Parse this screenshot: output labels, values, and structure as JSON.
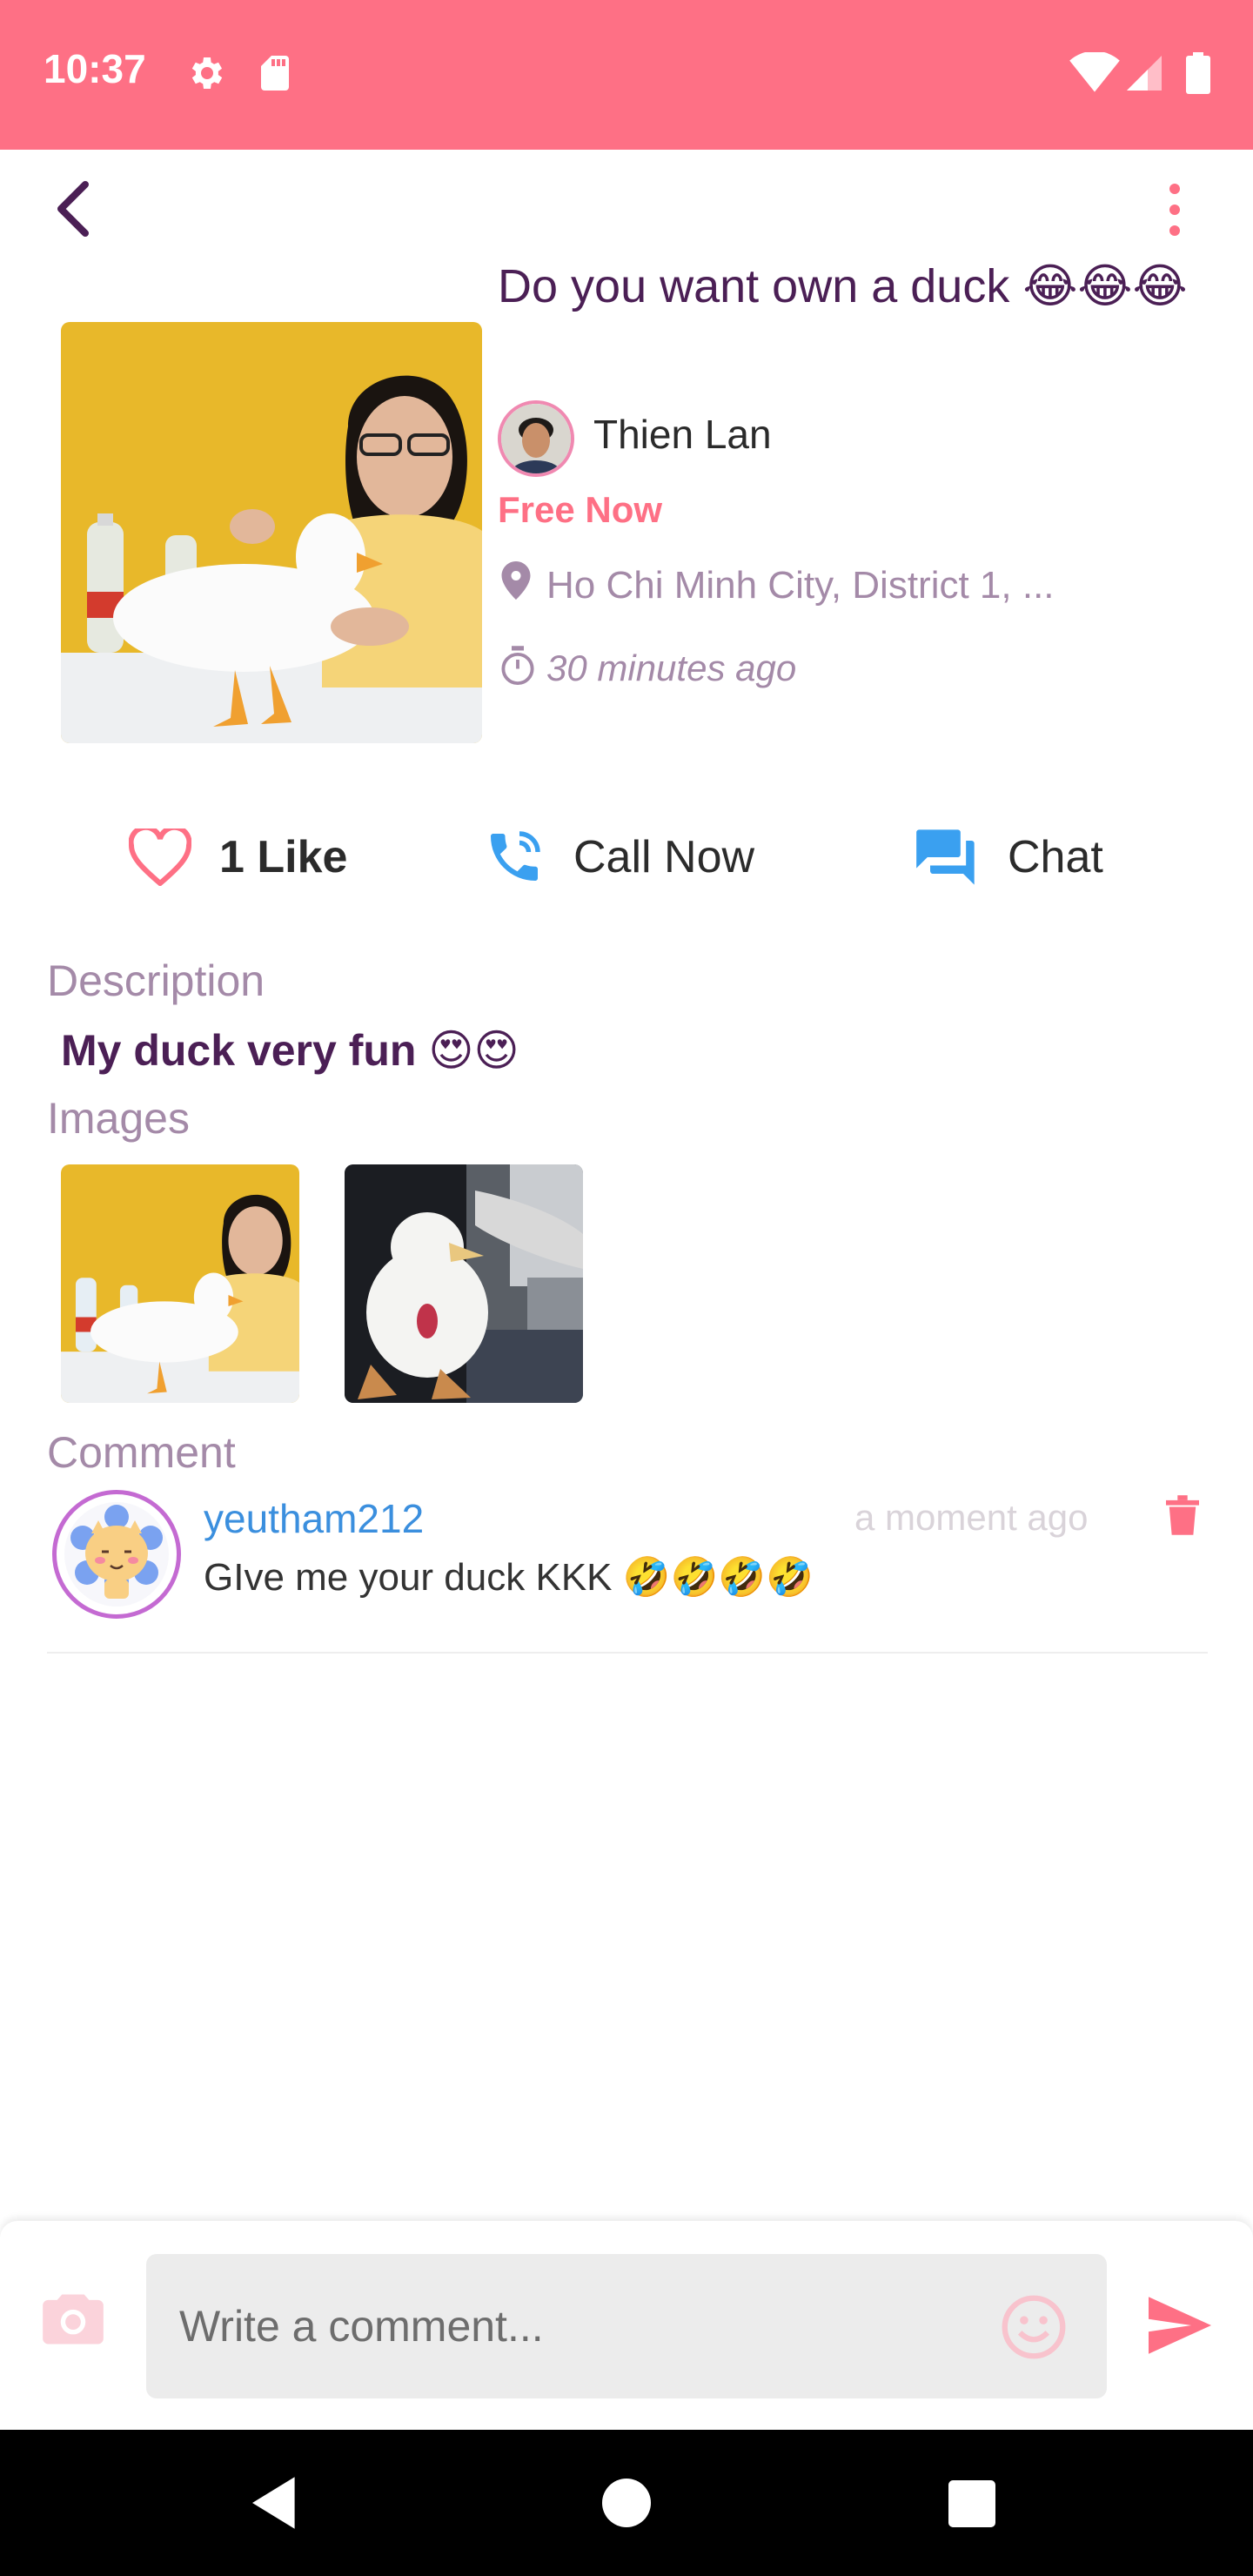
{
  "status_bar": {
    "time": "10:37",
    "icons": [
      "gear-icon",
      "sd-card-icon",
      "wifi-icon",
      "signal-icon",
      "battery-icon"
    ],
    "bg_color": "#fe7085"
  },
  "header": {
    "back_icon": "chevron-left-icon",
    "menu_icon": "more-vertical-icon"
  },
  "post": {
    "title": "Do you want own a duck 😂😂😂",
    "author_name": "Thien Lan",
    "status": "Free Now",
    "location": "Ho Chi Minh City, District 1, ...",
    "posted_time": "30 minutes ago"
  },
  "actions": {
    "like_label": "1 Like",
    "call_label": "Call Now",
    "chat_label": "Chat"
  },
  "description": {
    "heading": "Description",
    "text": "My duck very fun 😍😍"
  },
  "images": {
    "heading": "Images"
  },
  "comments": {
    "heading": "Comment",
    "items": [
      {
        "username": "yeutham212",
        "time": "a moment ago",
        "text": "GIve me your duck KKK 🤣🤣🤣🤣"
      }
    ]
  },
  "composer": {
    "placeholder": "Write a comment...",
    "value": ""
  },
  "colors": {
    "accent": "#fe7085",
    "title": "#4b1f55",
    "muted": "#a48aa8",
    "link": "#3b8fde",
    "icon_blue": "#3aa0f0"
  }
}
